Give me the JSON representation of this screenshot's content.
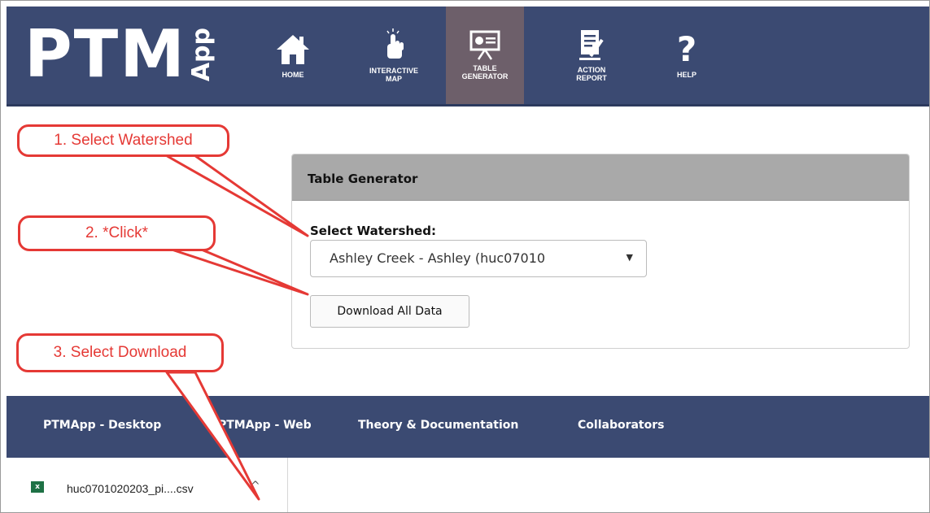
{
  "app": {
    "logo": {
      "letters": "PTM",
      "suffix": "App"
    }
  },
  "nav": {
    "items": [
      {
        "id": "home",
        "label": "HOME",
        "icon": "home-icon",
        "active": false
      },
      {
        "id": "interactive-map",
        "label": "INTERACTIVE\nMAP",
        "icon": "hand-pointer-icon",
        "active": false
      },
      {
        "id": "table-generator",
        "label": "TABLE\nGENERATOR",
        "icon": "presentation-icon",
        "active": true
      },
      {
        "id": "action-report",
        "label": "ACTION\nREPORT",
        "icon": "document-icon",
        "active": false
      },
      {
        "id": "help",
        "label": "HELP",
        "icon": "question-icon",
        "active": false
      }
    ]
  },
  "panel": {
    "title": "Table Generator",
    "select_label": "Select Watershed:",
    "select_value": "Ashley Creek - Ashley (huc07010",
    "download_button": "Download All Data"
  },
  "footer": {
    "links": [
      "PTMApp - Desktop",
      "PTMApp - Web",
      "Theory & Documentation",
      "Collaborators"
    ]
  },
  "download_bar": {
    "file_name": "huc0701020203_pi....csv",
    "file_icon": "excel-icon",
    "chevron": "^"
  },
  "callouts": {
    "step1": "1. Select Watershed",
    "step2": "2. *Click*",
    "step3": "3. Select Download"
  },
  "colors": {
    "header": "#3b4a72",
    "active_nav": "#6d5f6a",
    "panel_head": "#a9a9a9",
    "callout": "#e53935"
  }
}
